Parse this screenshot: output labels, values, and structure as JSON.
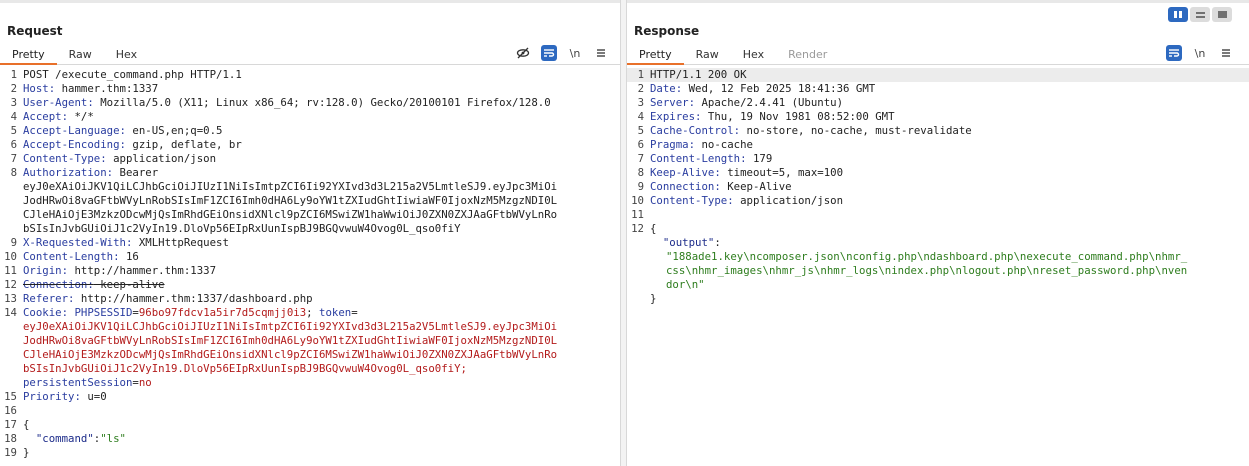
{
  "request": {
    "title": "Request",
    "tabs": [
      "Pretty",
      "Raw",
      "Hex"
    ],
    "tools": {
      "hide_icon": "eye-off-icon",
      "wrap_icon": "wrap-icon",
      "newline_label": "\\n",
      "menu_icon": "menu-icon"
    },
    "lines": {
      "l1": "POST /execute_command.php HTTP/1.1",
      "l2_key": "Host:",
      "l2_val": " hammer.thm:1337",
      "l3_key": "User-Agent:",
      "l3_val": " Mozilla/5.0 (X11; Linux x86_64; rv:128.0) Gecko/20100101 Firefox/128.0",
      "l4_key": "Accept:",
      "l4_val": " */*",
      "l5_key": "Accept-Language:",
      "l5_val": " en-US,en;q=0.5",
      "l6_key": "Accept-Encoding:",
      "l6_val": " gzip, deflate, br",
      "l7_key": "Content-Type:",
      "l7_val": " application/json",
      "l8_key": "Authorization:",
      "l8_val": " Bearer",
      "l8_c1": "eyJ0eXAiOiJKV1QiLCJhbGciOiJIUzI1NiIsImtpZCI6Ii92YXIvd3d3L215a2V5LmtleSJ9.eyJpc3MiOi",
      "l8_c2": "JodHRwOi8vaGFtbWVyLnRobSIsImF1ZCI6Imh0dHA6Ly9oYW1tZXIudGhtIiwiaWF0IjoxNzM5MzgzNDI0L",
      "l8_c3": "CJleHAiOjE3MzkzODcwMjQsImRhdGEiOnsidXNlcl9pZCI6MSwiZW1haWwiOiJ0ZXN0ZXJAaGFtbWVyLnRo",
      "l8_c4": "bSIsInJvbGUiOiJ1c2VyIn19.DloVp56EIpRxUunIspBJ9BGQvwuW4Ovog0L_qso0fiY",
      "l9_key": "X-Requested-With:",
      "l9_val": " XMLHttpRequest",
      "l10_key": "Content-Length:",
      "l10_val": " 16",
      "l11_key": "Origin:",
      "l11_val": " http://hammer.thm:1337",
      "l12_key": "Connection:",
      "l12_val": " keep-alive",
      "l13_key": "Referer:",
      "l13_val": " http://hammer.thm:1337/dashboard.php",
      "l14_key": "Cookie:",
      "l14_ck1": " PHPSESSID",
      "l14_eq1": "=",
      "l14_v1": "96bo97fdcv1a5ir7d5cqmjj0i3",
      "l14_semi": "; ",
      "l14_ck2": "token",
      "l14_eq2": "=",
      "l14_c1": "eyJ0eXAiOiJKV1QiLCJhbGciOiJIUzI1NiIsImtpZCI6Ii92YXIvd3d3L215a2V5LmtleSJ9.eyJpc3MiOi",
      "l14_c2": "JodHRwOi8vaGFtbWVyLnRobSIsImF1ZCI6Imh0dHA6Ly9oYW1tZXIudGhtIiwiaWF0IjoxNzM5MzgzNDI0L",
      "l14_c3": "CJleHAiOjE3MzkzODcwMjQsImRhdGEiOnsidXNlcl9pZCI6MSwiZW1haWwiOiJ0ZXN0ZXJAaGFtbWVyLnRo",
      "l14_c4": "bSIsInJvbGUiOiJ1c2VyIn19.DloVp56EIpRxUunIspBJ9BGQvwuW4Ovog0L_qso0fiY;",
      "l14_c5_key": "persistentSession",
      "l14_c5_eq": "=",
      "l14_c5_val": "no",
      "l15_key": "Priority:",
      "l15_val": " u=0",
      "l17": "{",
      "l18_key": "\"command\"",
      "l18_colon": ":",
      "l18_val": "\"ls\"",
      "l19": "}"
    },
    "line_numbers": [
      "1",
      "2",
      "3",
      "4",
      "5",
      "6",
      "7",
      "8",
      "9",
      "10",
      "11",
      "12",
      "13",
      "14",
      "15",
      "16",
      "17",
      "18",
      "19"
    ]
  },
  "response": {
    "title": "Response",
    "tabs": [
      "Pretty",
      "Raw",
      "Hex",
      "Render"
    ],
    "tools": {
      "wrap_icon": "wrap-icon",
      "newline_label": "\\n",
      "menu_icon": "menu-icon"
    },
    "lines": {
      "l1": "HTTP/1.1 200 OK",
      "l2_key": "Date:",
      "l2_val": " Wed, 12 Feb 2025 18:41:36 GMT",
      "l3_key": "Server:",
      "l3_val": " Apache/2.4.41 (Ubuntu)",
      "l4_key": "Expires:",
      "l4_val": " Thu, 19 Nov 1981 08:52:00 GMT",
      "l5_key": "Cache-Control:",
      "l5_val": " no-store, no-cache, must-revalidate",
      "l6_key": "Pragma:",
      "l6_val": " no-cache",
      "l7_key": "Content-Length:",
      "l7_val": " 179",
      "l8_key": "Keep-Alive:",
      "l8_val": " timeout=5, max=100",
      "l9_key": "Connection:",
      "l9_val": " Keep-Alive",
      "l10_key": "Content-Type:",
      "l10_val": " application/json",
      "l12": "{",
      "l13_key": "\"output\"",
      "l13_colon": ":",
      "l13_c1": "\"188ade1.key\\ncomposer.json\\nconfig.php\\ndashboard.php\\nexecute_command.php\\nhmr_",
      "l13_c2": "css\\nhmr_images\\nhmr_js\\nhmr_logs\\nindex.php\\nlogout.php\\nreset_password.php\\nven",
      "l13_c3": "dor\\n\"",
      "l14": "}"
    },
    "line_numbers": [
      "1",
      "2",
      "3",
      "4",
      "5",
      "6",
      "7",
      "8",
      "9",
      "10",
      "11",
      "12",
      "13",
      "14"
    ]
  },
  "layout_toggle": {
    "icons": [
      "side-by-side-icon",
      "stacked-icon",
      "single-icon"
    ]
  },
  "colors": {
    "accent_tab": "#e8702a",
    "tool_blue": "#2d69c0",
    "header_key": "#2a3da0",
    "value_red": "#b31b1b",
    "json_green": "#2e7d1e"
  }
}
